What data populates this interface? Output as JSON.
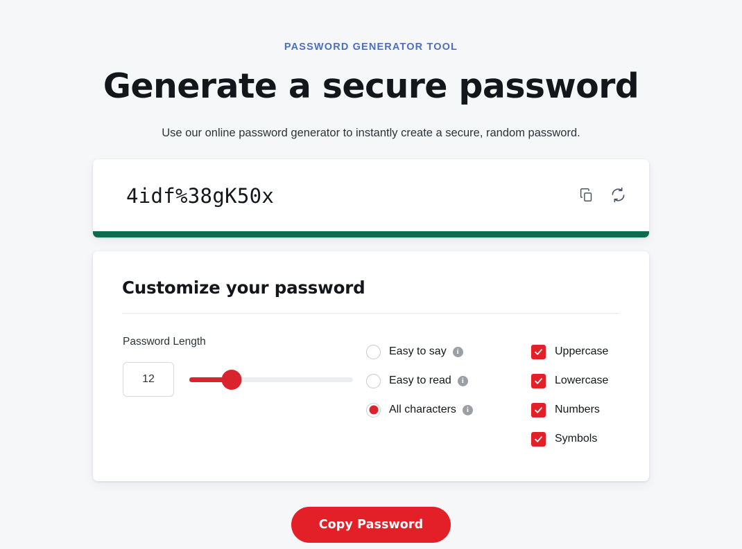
{
  "header": {
    "eyebrow": "PASSWORD GENERATOR TOOL",
    "headline": "Generate a secure password",
    "subhead": "Use our online password generator to instantly create a secure, random password."
  },
  "result": {
    "password": "4idf%38gK50x",
    "copy_icon": "copy-icon",
    "refresh_icon": "refresh-icon",
    "strength_color": "#0b6b4f"
  },
  "customize": {
    "title": "Customize your password",
    "length": {
      "label": "Password Length",
      "value": "12",
      "slider_percent": 26
    },
    "radios": [
      {
        "label": "Easy to say",
        "selected": false,
        "info_icon": "info-icon"
      },
      {
        "label": "Easy to read",
        "selected": false,
        "info_icon": "info-icon"
      },
      {
        "label": "All characters",
        "selected": true,
        "info_icon": "info-icon"
      }
    ],
    "checkboxes": [
      {
        "label": "Uppercase",
        "checked": true
      },
      {
        "label": "Lowercase",
        "checked": true
      },
      {
        "label": "Numbers",
        "checked": true
      },
      {
        "label": "Symbols",
        "checked": true
      }
    ]
  },
  "cta": {
    "label": "Copy Password"
  },
  "colors": {
    "accent_red": "#e32028",
    "eyebrow_blue": "#4a6fc4",
    "strength_green": "#0b6b4f",
    "page_bg": "#f6f7f9"
  }
}
